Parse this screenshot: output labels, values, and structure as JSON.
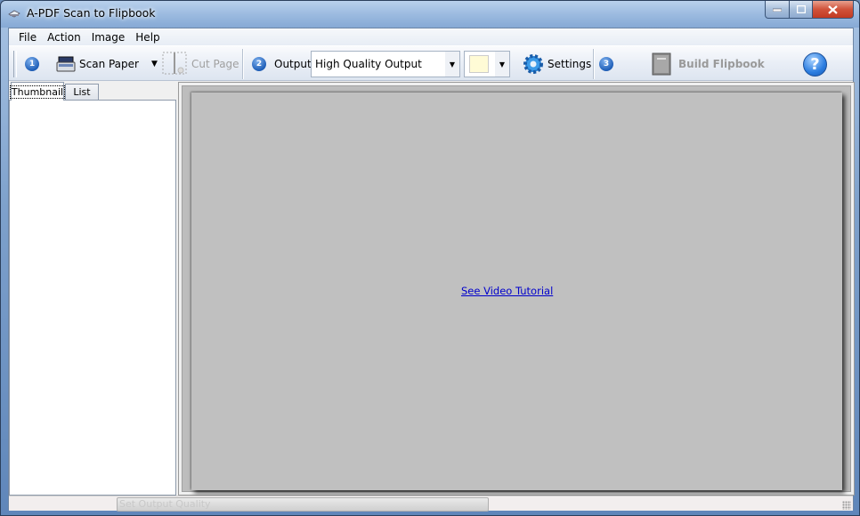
{
  "window": {
    "title": "A-PDF Scan to Flipbook"
  },
  "menu": {
    "items": [
      "File",
      "Action",
      "Image",
      "Help"
    ]
  },
  "toolbar": {
    "step1": "1",
    "scan_paper": "Scan Paper",
    "cut_page": "Cut Page",
    "step2": "2",
    "output_label": "Output:",
    "output_value": "High Quality Output",
    "color_swatch": "#fffbd6",
    "settings": "Settings",
    "step3": "3",
    "build_flipbook": "Build Flipbook",
    "help": "?"
  },
  "left_panel": {
    "tabs": [
      "Thumbnail",
      "List"
    ],
    "active_tab": "Thumbnail"
  },
  "viewer": {
    "link": "See Video Tutorial"
  },
  "statusbar": {
    "progress_text": "Set Output Quality"
  }
}
